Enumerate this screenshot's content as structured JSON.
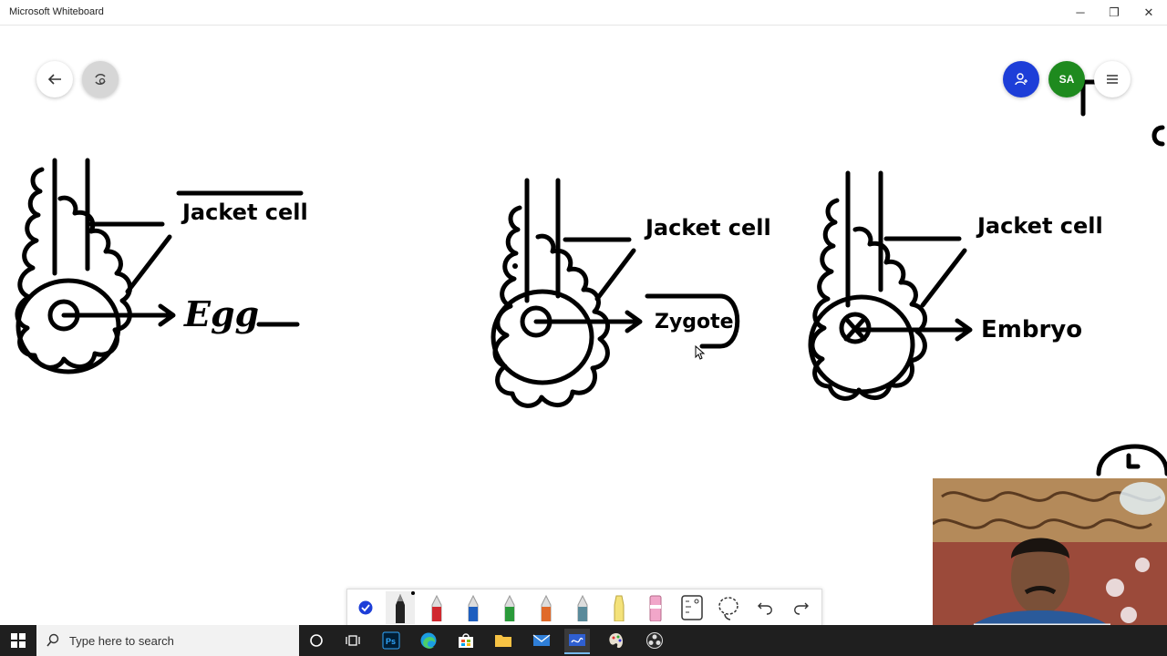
{
  "window": {
    "title": "Microsoft Whiteboard",
    "minimize": "─",
    "restore": "❐",
    "close": "✕"
  },
  "top_controls": {
    "avatar_initials": "SA"
  },
  "canvas": {
    "label_jacket_1": "Jacket cell",
    "label_egg": "Egg",
    "label_jacket_2": "Jacket cell",
    "label_zygote": "Zygote",
    "label_jacket_3": "Jacket cell",
    "label_embryo": "Embryo"
  },
  "toolbar": {
    "tools": [
      "select-tool",
      "black-pen",
      "red-pen",
      "blue-pen",
      "green-pen",
      "orange-pen",
      "teal-pen",
      "highlighter",
      "eraser",
      "ruler",
      "lasso",
      "undo",
      "redo"
    ]
  },
  "taskbar": {
    "search_placeholder": "Type here to search",
    "apps": [
      "cortana",
      "task-view",
      "photoshop",
      "edge",
      "store",
      "file-explorer",
      "mail",
      "whiteboard",
      "paint-3d",
      "obs"
    ]
  },
  "colors": {
    "share_button": "#1d3ed8",
    "avatar": "#1e8a1e",
    "taskbar": "#1f1f1f"
  }
}
